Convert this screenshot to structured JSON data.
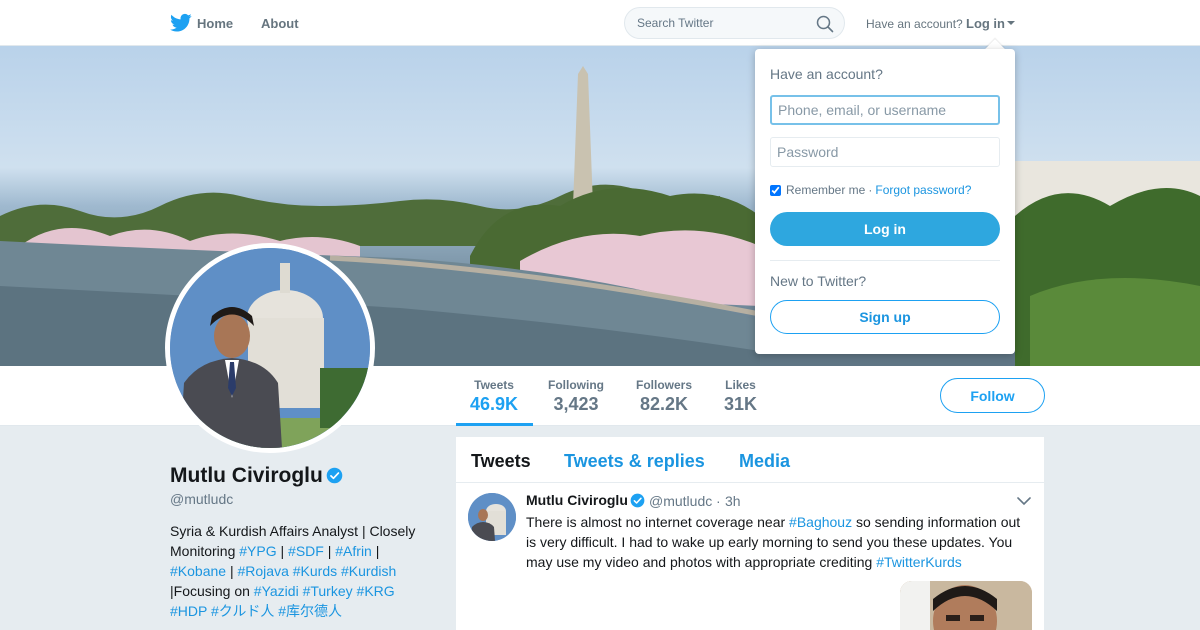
{
  "nav": {
    "home_label": "Home",
    "about_label": "About",
    "search_placeholder": "Search Twitter",
    "have_account_text": "Have an account?",
    "login_label": "Log in",
    "logo_icon": "twitter-bird-icon",
    "search_icon": "magnifier-icon",
    "caret_icon": "caret-down-icon"
  },
  "profile": {
    "name": "Mutlu Civiroglu",
    "handle": "@mutludc",
    "verified": true,
    "bio": [
      {
        "t": "Syria & Kurdish Affairs Analyst | Closely Monitoring ",
        "tag": false
      },
      {
        "t": "#YPG",
        "tag": true
      },
      {
        "t": " | ",
        "tag": false
      },
      {
        "t": "#SDF",
        "tag": true
      },
      {
        "t": " | ",
        "tag": false
      },
      {
        "t": "#Afrin",
        "tag": true
      },
      {
        "t": " | ",
        "tag": false
      },
      {
        "t": "#Kobane",
        "tag": true
      },
      {
        "t": " | ",
        "tag": false
      },
      {
        "t": "#Rojava",
        "tag": true
      },
      {
        "t": " ",
        "tag": false
      },
      {
        "t": "#Kurds",
        "tag": true
      },
      {
        "t": " ",
        "tag": false
      },
      {
        "t": "#Kurdish",
        "tag": true
      },
      {
        "t": " |Focusing on ",
        "tag": false
      },
      {
        "t": "#Yazidi",
        "tag": true
      },
      {
        "t": " ",
        "tag": false
      },
      {
        "t": "#Turkey",
        "tag": true
      },
      {
        "t": " ",
        "tag": false
      },
      {
        "t": "#KRG",
        "tag": true
      },
      {
        "t": " ",
        "tag": false
      },
      {
        "t": "#HDP",
        "tag": true
      },
      {
        "t": " ",
        "tag": false
      },
      {
        "t": "#クルド人",
        "tag": true
      },
      {
        "t": " ",
        "tag": false
      },
      {
        "t": "#库尔德人",
        "tag": true
      }
    ]
  },
  "stats": {
    "tweets": {
      "label": "Tweets",
      "value": "46.9K"
    },
    "following": {
      "label": "Following",
      "value": "3,423"
    },
    "followers": {
      "label": "Followers",
      "value": "82.2K"
    },
    "likes": {
      "label": "Likes",
      "value": "31K"
    }
  },
  "follow_label": "Follow",
  "timeline": {
    "tabs": [
      "Tweets",
      "Tweets & replies",
      "Media"
    ],
    "active_tab": "Tweets",
    "tweet": {
      "name": "Mutlu Civiroglu",
      "handle": "@mutludc",
      "dot": "·",
      "time": "3h",
      "text": [
        {
          "t": "There is almost no internet coverage near ",
          "tag": false
        },
        {
          "t": "#Baghouz",
          "tag": true
        },
        {
          "t": " so sending information out is very difficult. I had to wake up early morning to send you these updates. You may use my video and photos with appropriate crediting ",
          "tag": false
        },
        {
          "t": "#TwitterKurds",
          "tag": true
        }
      ]
    }
  },
  "login_dropdown": {
    "title": "Have an account?",
    "username_placeholder": "Phone, email, or username",
    "password_placeholder": "Password",
    "remember_label": "Remember me",
    "separator": "·",
    "forgot_label": "Forgot password?",
    "remember_checked": true,
    "login_button": "Log in",
    "new_to_text": "New to Twitter?",
    "signup_button": "Sign up"
  },
  "colors": {
    "accent": "#1da1f2",
    "link": "#1b95e0",
    "login_button_bg": "#2ea7df",
    "page_bg": "#e6ecf0"
  }
}
